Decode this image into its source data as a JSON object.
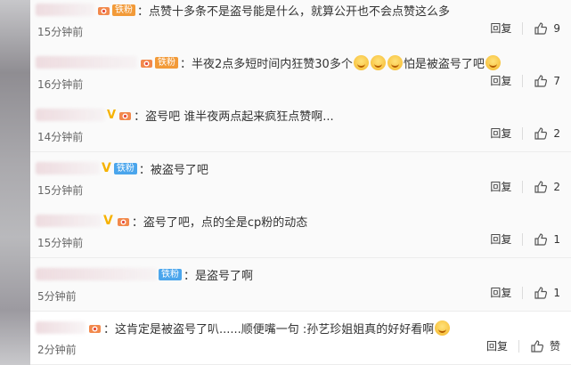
{
  "comments": [
    {
      "text": "：点赞十多条不是盗号能是什么，就算公开也不会点赞这么多",
      "badge": "铁粉",
      "time": "15分钟前",
      "reply": "回复",
      "likes": "9"
    },
    {
      "text_a": "：半夜2点多短时间内狂赞30多个",
      "text_b": "怕是被盗号了吧",
      "badge": "铁粉",
      "time": "16分钟前",
      "reply": "回复",
      "likes": "7"
    },
    {
      "text": "：盗号吧 谁半夜两点起来疯狂点赞啊...",
      "time": "14分钟前",
      "reply": "回复",
      "likes": "2"
    },
    {
      "text": "：被盗号了吧",
      "badge": "铁粉",
      "time": "15分钟前",
      "reply": "回复",
      "likes": "2"
    },
    {
      "text": "：盗号了吧，点的全是cp粉的动态",
      "time": "15分钟前",
      "reply": "回复",
      "likes": "1"
    },
    {
      "text": "：是盗号了啊",
      "badge": "铁粉",
      "time": "5分钟前",
      "reply": "回复",
      "likes": "1"
    },
    {
      "text": "：这肯定是被盗号了叭......顺便嘴一句 :孙艺珍姐姐真的好好看啊",
      "time": "2分钟前",
      "reply": "回复",
      "like_label": "赞"
    }
  ],
  "icons": {
    "vip": "vip-crown-icon",
    "like": "thumbs-up-icon",
    "emoji": "smile-emoji-icon"
  },
  "colors": {
    "fan_badge": "#f29a38",
    "fan_badge_blue": "#4aa5ec"
  }
}
